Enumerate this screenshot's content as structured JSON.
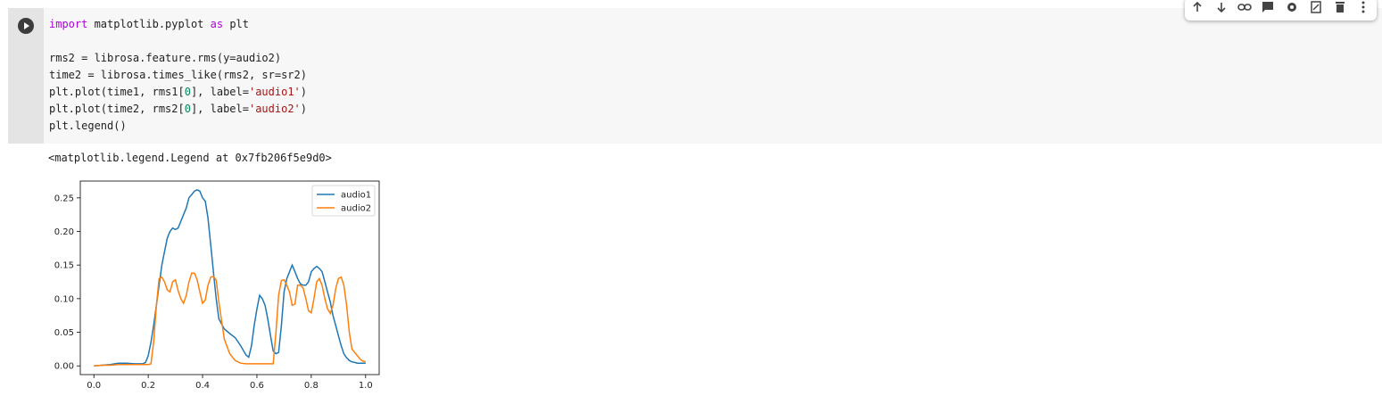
{
  "toolbar": {
    "icons": [
      "arrow-up-icon",
      "arrow-down-icon",
      "link-icon",
      "comment-icon",
      "gear-icon",
      "mirror-cell-icon",
      "delete-icon",
      "more-vert-icon"
    ]
  },
  "code_lines": [
    [
      {
        "t": "import",
        "c": "kw"
      },
      {
        "t": " matplotlib.pyplot ",
        "c": ""
      },
      {
        "t": "as",
        "c": "kw"
      },
      {
        "t": " plt",
        "c": ""
      }
    ],
    [],
    [
      {
        "t": "rms2 = librosa.feature.rms(y=audio2)",
        "c": ""
      }
    ],
    [
      {
        "t": "time2 = librosa.times_like(rms2, sr=sr2)",
        "c": ""
      }
    ],
    [
      {
        "t": "plt.plot(time1, rms1[",
        "c": ""
      },
      {
        "t": "0",
        "c": "num"
      },
      {
        "t": "], label=",
        "c": ""
      },
      {
        "t": "'audio1'",
        "c": "str"
      },
      {
        "t": ")",
        "c": ""
      }
    ],
    [
      {
        "t": "plt.plot(time2, rms2[",
        "c": ""
      },
      {
        "t": "0",
        "c": "num"
      },
      {
        "t": "], label=",
        "c": ""
      },
      {
        "t": "'audio2'",
        "c": "str"
      },
      {
        "t": ")",
        "c": ""
      }
    ],
    [
      {
        "t": "plt.legend()",
        "c": ""
      }
    ]
  ],
  "output_text": "<matplotlib.legend.Legend at 0x7fb206f5e9d0>",
  "chart_data": {
    "type": "line",
    "xlim": [
      -0.05,
      1.05
    ],
    "ylim": [
      -0.013,
      0.275
    ],
    "xticks": [
      0.0,
      0.2,
      0.4,
      0.6,
      0.8,
      1.0
    ],
    "xtick_labels": [
      "0.0",
      "0.2",
      "0.4",
      "0.6",
      "0.8",
      "1.0"
    ],
    "yticks": [
      0.0,
      0.05,
      0.1,
      0.15,
      0.2,
      0.25
    ],
    "ytick_labels": [
      "0.00",
      "0.05",
      "0.10",
      "0.15",
      "0.20",
      "0.25"
    ],
    "grid": false,
    "legend_position": "upper right",
    "series": [
      {
        "name": "audio1",
        "color": "#1f77b4",
        "x": [
          0.0,
          0.03,
          0.06,
          0.09,
          0.12,
          0.15,
          0.18,
          0.19,
          0.2,
          0.21,
          0.22,
          0.23,
          0.24,
          0.25,
          0.26,
          0.27,
          0.28,
          0.29,
          0.3,
          0.31,
          0.32,
          0.33,
          0.34,
          0.35,
          0.36,
          0.37,
          0.38,
          0.39,
          0.4,
          0.41,
          0.42,
          0.43,
          0.44,
          0.45,
          0.46,
          0.48,
          0.5,
          0.52,
          0.54,
          0.56,
          0.57,
          0.58,
          0.59,
          0.6,
          0.61,
          0.62,
          0.63,
          0.64,
          0.65,
          0.66,
          0.67,
          0.68,
          0.69,
          0.7,
          0.71,
          0.72,
          0.73,
          0.74,
          0.75,
          0.76,
          0.77,
          0.78,
          0.79,
          0.8,
          0.81,
          0.82,
          0.83,
          0.84,
          0.85,
          0.86,
          0.87,
          0.88,
          0.89,
          0.9,
          0.91,
          0.92,
          0.93,
          0.94,
          0.95,
          0.96,
          0.97,
          0.98,
          0.99,
          1.0
        ],
        "y": [
          0.0,
          0.001,
          0.002,
          0.004,
          0.004,
          0.003,
          0.003,
          0.005,
          0.015,
          0.035,
          0.06,
          0.09,
          0.12,
          0.15,
          0.17,
          0.19,
          0.2,
          0.205,
          0.203,
          0.205,
          0.215,
          0.225,
          0.235,
          0.25,
          0.255,
          0.26,
          0.262,
          0.26,
          0.25,
          0.245,
          0.22,
          0.18,
          0.14,
          0.1,
          0.07,
          0.055,
          0.048,
          0.042,
          0.03,
          0.016,
          0.013,
          0.03,
          0.06,
          0.085,
          0.105,
          0.1,
          0.09,
          0.07,
          0.045,
          0.022,
          0.018,
          0.02,
          0.06,
          0.11,
          0.13,
          0.14,
          0.15,
          0.14,
          0.13,
          0.122,
          0.12,
          0.12,
          0.125,
          0.14,
          0.145,
          0.148,
          0.145,
          0.14,
          0.125,
          0.11,
          0.095,
          0.075,
          0.06,
          0.045,
          0.03,
          0.018,
          0.012,
          0.008,
          0.006,
          0.005,
          0.004,
          0.004,
          0.004,
          0.004
        ]
      },
      {
        "name": "audio2",
        "color": "#ff7f0e",
        "x": [
          0.0,
          0.03,
          0.06,
          0.09,
          0.12,
          0.15,
          0.18,
          0.19,
          0.2,
          0.21,
          0.22,
          0.23,
          0.24,
          0.25,
          0.26,
          0.27,
          0.28,
          0.29,
          0.3,
          0.31,
          0.32,
          0.33,
          0.34,
          0.35,
          0.36,
          0.37,
          0.38,
          0.39,
          0.4,
          0.41,
          0.42,
          0.43,
          0.44,
          0.45,
          0.46,
          0.48,
          0.5,
          0.52,
          0.54,
          0.56,
          0.57,
          0.58,
          0.59,
          0.6,
          0.61,
          0.62,
          0.63,
          0.64,
          0.65,
          0.66,
          0.67,
          0.68,
          0.69,
          0.7,
          0.71,
          0.72,
          0.73,
          0.74,
          0.75,
          0.76,
          0.77,
          0.78,
          0.79,
          0.8,
          0.81,
          0.82,
          0.83,
          0.84,
          0.85,
          0.86,
          0.87,
          0.88,
          0.89,
          0.9,
          0.91,
          0.92,
          0.93,
          0.94,
          0.95,
          0.96,
          0.97,
          0.98,
          0.99,
          1.0
        ],
        "y": [
          0.0,
          0.001,
          0.001,
          0.002,
          0.002,
          0.002,
          0.002,
          0.002,
          0.002,
          0.003,
          0.035,
          0.09,
          0.13,
          0.132,
          0.125,
          0.113,
          0.11,
          0.125,
          0.128,
          0.112,
          0.1,
          0.093,
          0.105,
          0.125,
          0.138,
          0.138,
          0.128,
          0.11,
          0.093,
          0.098,
          0.12,
          0.132,
          0.133,
          0.128,
          0.095,
          0.04,
          0.018,
          0.008,
          0.004,
          0.003,
          0.003,
          0.003,
          0.003,
          0.003,
          0.003,
          0.003,
          0.003,
          0.003,
          0.003,
          0.003,
          0.05,
          0.105,
          0.127,
          0.128,
          0.12,
          0.11,
          0.09,
          0.092,
          0.12,
          0.12,
          0.116,
          0.1,
          0.082,
          0.079,
          0.1,
          0.125,
          0.13,
          0.12,
          0.1,
          0.085,
          0.078,
          0.09,
          0.115,
          0.13,
          0.132,
          0.12,
          0.09,
          0.05,
          0.025,
          0.02,
          0.015,
          0.01,
          0.007,
          0.006
        ]
      }
    ]
  }
}
